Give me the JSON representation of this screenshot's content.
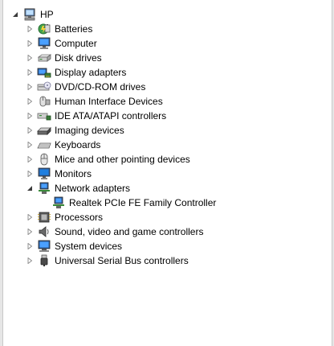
{
  "tree": {
    "root": {
      "label": "HP",
      "icon": "computer-root-icon",
      "expanded": true
    },
    "categories": [
      {
        "label": "Batteries",
        "icon": "battery-icon",
        "expanded": false
      },
      {
        "label": "Computer",
        "icon": "computer-monitor-icon",
        "expanded": false
      },
      {
        "label": "Disk drives",
        "icon": "disk-drive-icon",
        "expanded": false
      },
      {
        "label": "Display adapters",
        "icon": "display-adapter-icon",
        "expanded": false
      },
      {
        "label": "DVD/CD-ROM drives",
        "icon": "dvd-drive-icon",
        "expanded": false
      },
      {
        "label": "Human Interface Devices",
        "icon": "hid-icon",
        "expanded": false
      },
      {
        "label": "IDE ATA/ATAPI controllers",
        "icon": "ide-controller-icon",
        "expanded": false
      },
      {
        "label": "Imaging devices",
        "icon": "imaging-device-icon",
        "expanded": false
      },
      {
        "label": "Keyboards",
        "icon": "keyboard-icon",
        "expanded": false
      },
      {
        "label": "Mice and other pointing devices",
        "icon": "mouse-icon",
        "expanded": false
      },
      {
        "label": "Monitors",
        "icon": "monitor-icon",
        "expanded": false
      },
      {
        "label": "Network adapters",
        "icon": "network-adapter-icon",
        "expanded": true,
        "children": [
          {
            "label": "Realtek PCIe FE Family Controller",
            "icon": "network-adapter-icon"
          }
        ]
      },
      {
        "label": "Processors",
        "icon": "processor-icon",
        "expanded": false
      },
      {
        "label": "Sound, video and game controllers",
        "icon": "speaker-icon",
        "expanded": false
      },
      {
        "label": "System devices",
        "icon": "system-device-icon",
        "expanded": false
      },
      {
        "label": "Universal Serial Bus controllers",
        "icon": "usb-icon",
        "expanded": false
      }
    ]
  }
}
